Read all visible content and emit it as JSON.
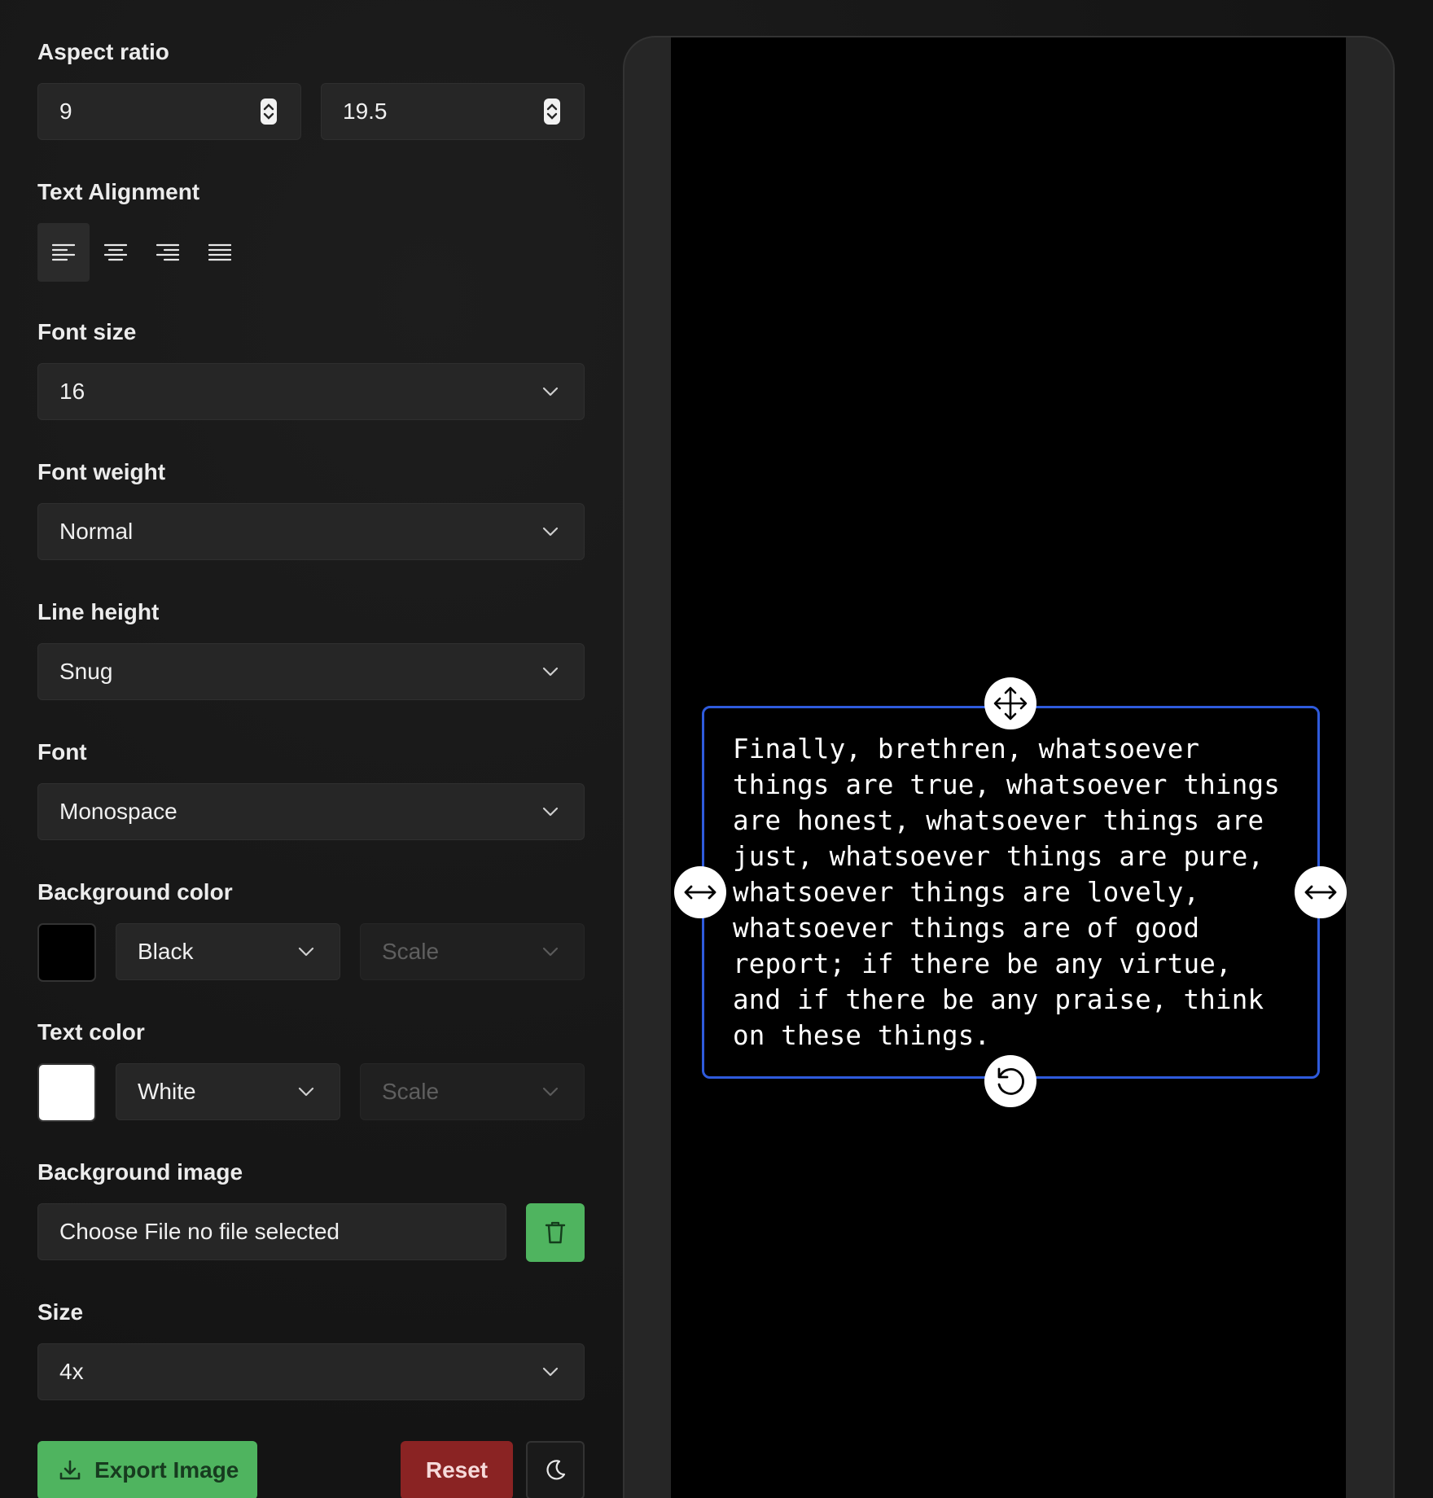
{
  "aspect_ratio": {
    "label": "Aspect ratio",
    "width_value": "9",
    "height_value": "19.5"
  },
  "text_alignment": {
    "label": "Text Alignment",
    "options": [
      "left",
      "center",
      "right",
      "justify"
    ],
    "selected": "left"
  },
  "font_size": {
    "label": "Font size",
    "value": "16"
  },
  "font_weight": {
    "label": "Font weight",
    "value": "Normal"
  },
  "line_height": {
    "label": "Line height",
    "value": "Snug"
  },
  "font": {
    "label": "Font",
    "value": "Monospace"
  },
  "background_color": {
    "label": "Background color",
    "swatch": "#000000",
    "value": "Black",
    "scale_placeholder": "Scale"
  },
  "text_color": {
    "label": "Text color",
    "swatch": "#ffffff",
    "value": "White",
    "scale_placeholder": "Scale"
  },
  "background_image": {
    "label": "Background image",
    "file_input_text": "Choose File no file selected",
    "delete_icon": "trash-icon"
  },
  "size": {
    "label": "Size",
    "value": "4x"
  },
  "actions": {
    "export_label": "Export Image",
    "export_icon": "download-icon",
    "reset_label": "Reset",
    "theme_icon": "moon-icon"
  },
  "preview": {
    "text": "Finally, brethren, whatsoever\nthings are true, whatsoever things\nare honest, whatsoever things are\njust, whatsoever things are pure,\nwhatsoever things are lovely,\nwhatsoever things are of good\nreport; if there be any virtue,\nand if there be any praise, think\non these things.",
    "handles": [
      "move-icon",
      "resize-left-icon",
      "resize-right-icon",
      "rotate-icon"
    ]
  },
  "colors": {
    "accent_green": "#4fb45f",
    "reset_red": "#8a2323",
    "selection_blue": "#2f5bdc"
  }
}
